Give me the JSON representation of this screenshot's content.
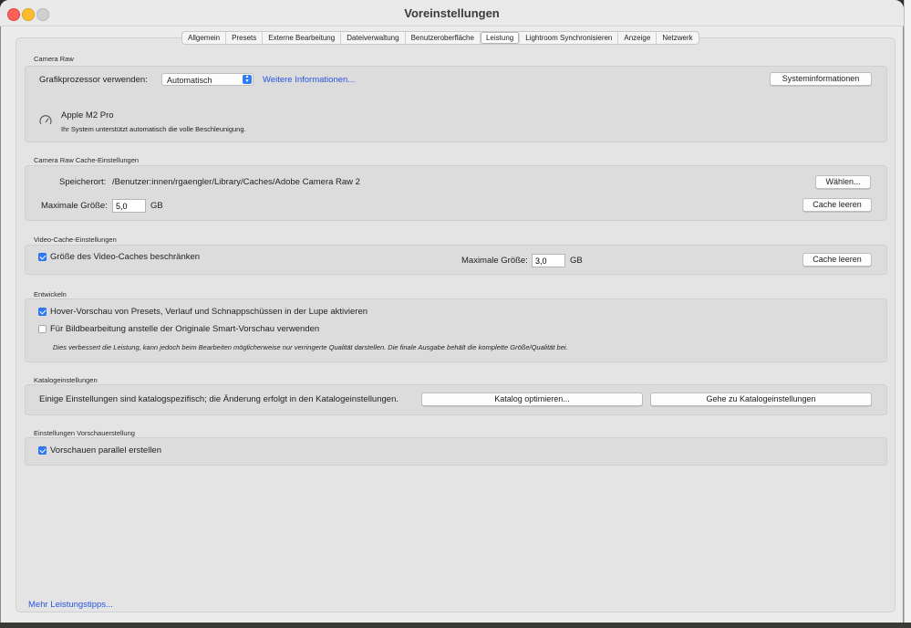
{
  "window": {
    "title": "Voreinstellungen"
  },
  "tabs": [
    "Allgemein",
    "Presets",
    "Externe Bearbeitung",
    "Dateiverwaltung",
    "Benutzeroberfläche",
    "Leistung",
    "Lightroom Synchronisieren",
    "Anzeige",
    "Netzwerk"
  ],
  "active_tab": "Leistung",
  "camera_raw": {
    "section_title": "Camera Raw",
    "gpu_label": "Grafikprozessor verwenden:",
    "gpu_value": "Automatisch",
    "more_info_link": "Weitere Informationen...",
    "system_info_button": "Systeminformationen",
    "gpu_name": "Apple M2 Pro",
    "gpu_status": "Ihr System unterstützt automatisch die volle Beschleunigung.",
    "gauge_icon": "speedometer-icon"
  },
  "cache": {
    "section_title": "Camera Raw Cache-Einstellungen",
    "location_label": "Speicherort:",
    "location_value": "/Benutzer:innen/rgaengler/Library/Caches/Adobe Camera Raw 2",
    "choose_button": "Wählen...",
    "max_size_label": "Maximale Größe:",
    "max_size_value": "5,0",
    "unit": "GB",
    "clear_button": "Cache leeren"
  },
  "video_cache": {
    "section_title": "Video-Cache-Einstellungen",
    "limit_label": "Größe des Video-Caches beschränken",
    "limit_checked": true,
    "max_size_label": "Maximale Größe:",
    "max_size_value": "3,0",
    "unit": "GB",
    "clear_button": "Cache leeren"
  },
  "develop": {
    "section_title": "Entwickeln",
    "hover_label": "Hover-Vorschau von Presets, Verlauf und Schnappschüssen in der Lupe aktivieren",
    "hover_checked": true,
    "smart_preview_label": "Für Bildbearbeitung anstelle der Originale Smart-Vorschau verwenden",
    "smart_preview_checked": false,
    "note": "Dies verbessert die Leistung, kann jedoch beim Bearbeiten möglicherweise nur verringerte Qualität darstellen. Die finale Ausgabe behält die komplette Größe/Qualität bei."
  },
  "catalog": {
    "section_title": "Katalogeinstellungen",
    "description": "Einige Einstellungen sind katalogspezifisch; die Änderung erfolgt in den Katalogeinstellungen.",
    "optimize_button": "Katalog optimieren...",
    "goto_button": "Gehe zu Katalogeinstellungen"
  },
  "preview": {
    "section_title": "Einstellungen Vorschauerstellung",
    "parallel_label": "Vorschauen parallel erstellen",
    "parallel_checked": true
  },
  "footer": {
    "tips_link": "Mehr Leistungstipps..."
  },
  "colors": {
    "accent": "#2f7cf6",
    "link": "#2a55e0"
  }
}
